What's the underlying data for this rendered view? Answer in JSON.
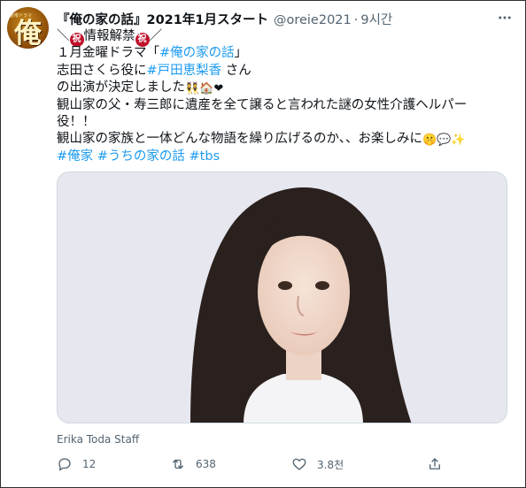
{
  "account": {
    "avatar_glyph": "俺",
    "avatar_tiny_text": "金曜ドラマ",
    "display_name": "『俺の家の話』2021年1月スタート",
    "handle": "@oreie2021",
    "separator": "·",
    "time": "9시간"
  },
  "tweet": {
    "line1_prefix": "＼",
    "stamp_char": "祝",
    "line1_text": "情報解禁",
    "line1_suffix": "／",
    "line2_text": "１月金曜ドラマ「",
    "line2_tag": "#俺の家の話",
    "line2_end": "」",
    "line3_text": "志田さくら役に",
    "line3_tag": "#戸田恵梨香",
    "line3_end": "さん",
    "line4_text": "の出演が決定しました",
    "line4_emoji": "👯🏠❤",
    "line5_text": "観山家の父・寿三郎に遺産を全て譲ると言われた謎の女性介護ヘルパー役！！",
    "line6_text": "観山家の家族と一体どんな物語を繰り広げるのか、、お楽しみに",
    "line6_emoji": "🤫💬✨",
    "hashtags": [
      "#俺家",
      "#うちの家の話",
      "#tbs"
    ]
  },
  "media": {
    "photo_credit": "Erika Toda Staff"
  },
  "actions": {
    "reply_count": "12",
    "retweet_count": "638",
    "like_count": "3.8천"
  },
  "colors": {
    "link": "#1d9bf0",
    "secondary_text": "#536471",
    "stamp_red": "#c0122a"
  }
}
